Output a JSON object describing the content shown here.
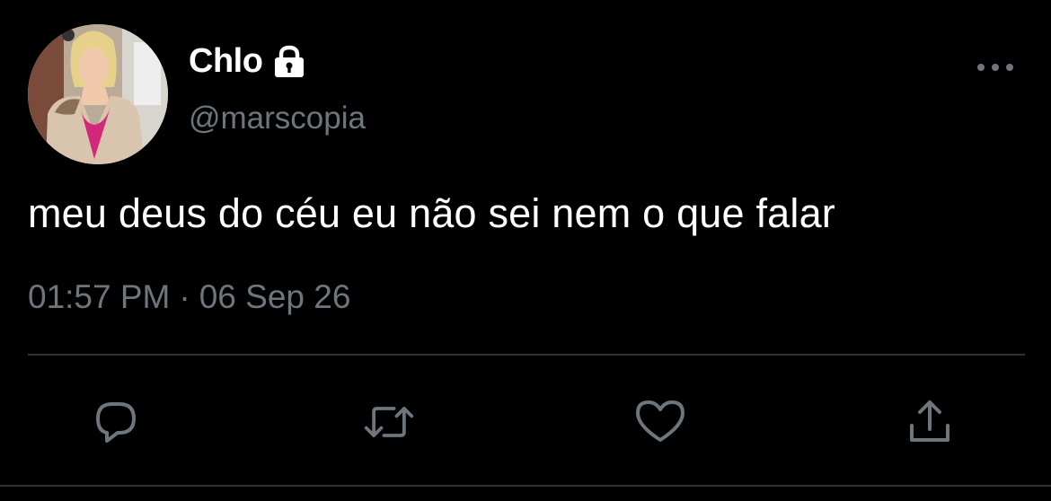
{
  "tweet": {
    "author": {
      "display_name": "Chlo",
      "handle": "@marscopia",
      "protected_icon": "lock-icon"
    },
    "text": "meu deus do céu eu não sei nem o que falar",
    "time": "01:57 PM",
    "separator": "·",
    "date": "06 Sep 26"
  },
  "actions": {
    "reply_icon": "reply-icon",
    "retweet_icon": "retweet-icon",
    "like_icon": "heart-icon",
    "share_icon": "share-icon",
    "more_icon": "more-icon"
  },
  "colors": {
    "background": "#000000",
    "text_primary": "#ffffff",
    "text_secondary": "#6e767d",
    "divider": "#2f3336"
  }
}
